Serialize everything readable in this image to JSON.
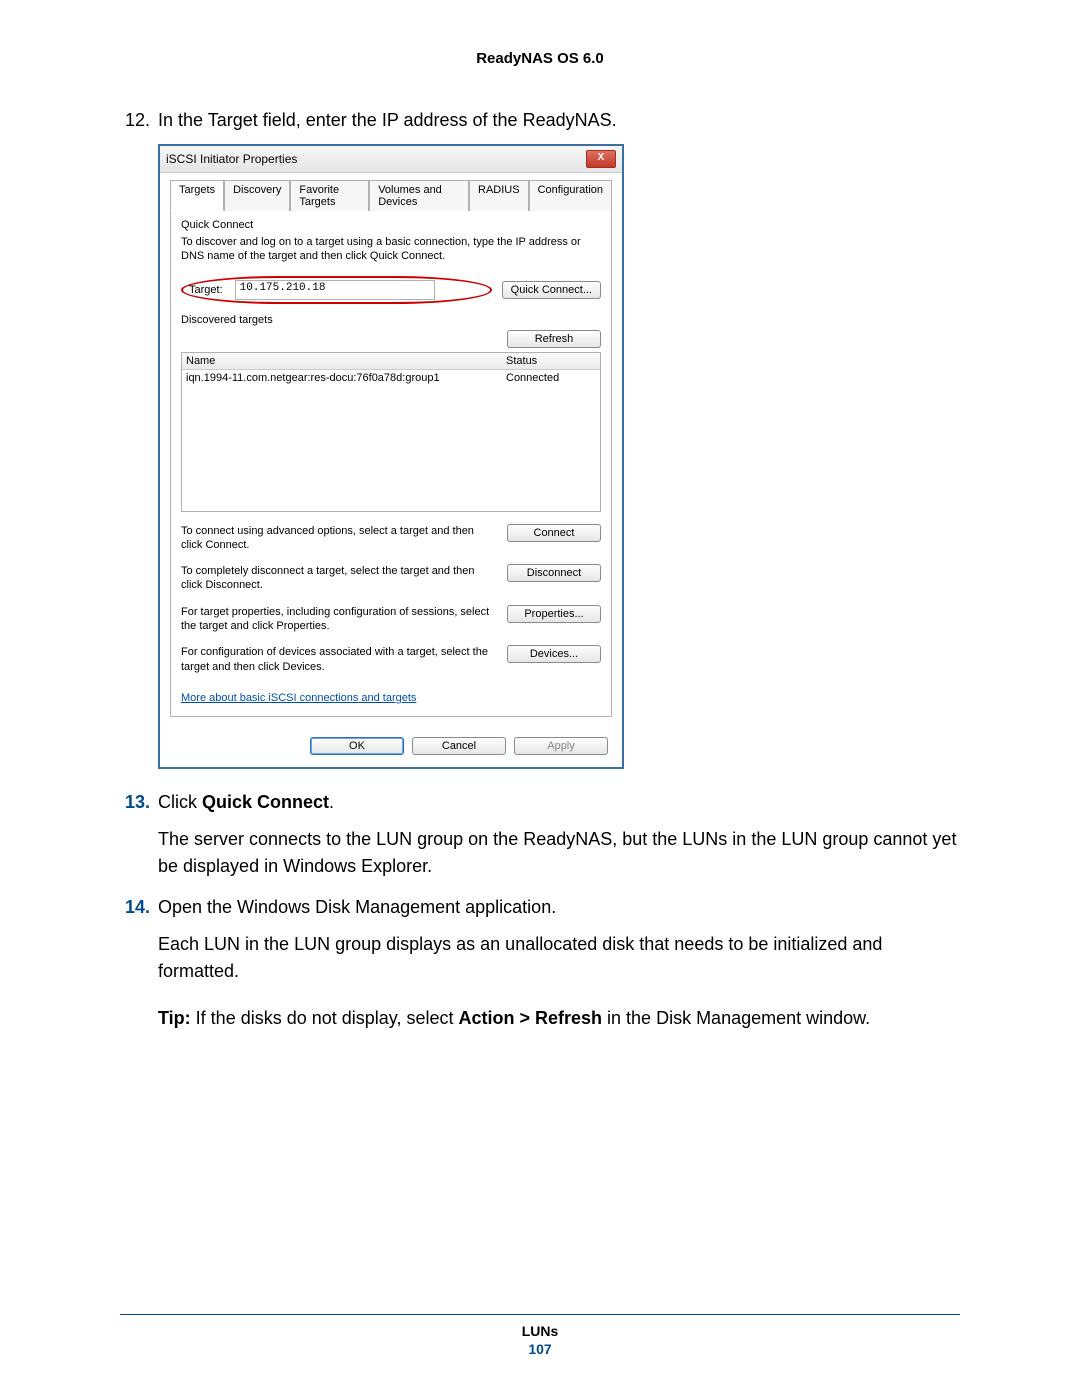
{
  "doc_header": "ReadyNAS OS 6.0",
  "steps": {
    "s12": {
      "num": "12.",
      "text": "In the Target field, enter the IP address of the ReadyNAS."
    },
    "s13": {
      "num": "13.",
      "text_pre": "Click ",
      "bold": "Quick Connect",
      "text_post": "."
    },
    "s13_sub": "The server connects to the LUN group on the ReadyNAS, but the LUNs in the LUN group cannot yet be displayed in Windows Explorer.",
    "s14": {
      "num": "14.",
      "text": "Open the Windows Disk Management application."
    },
    "s14_sub": "Each LUN in the LUN group displays as an unallocated disk that needs to be initialized and formatted.",
    "tip_label": "Tip:",
    "tip_pre": "  If the disks do not display, select ",
    "tip_bold": "Action > Refresh",
    "tip_post": " in the Disk Management window."
  },
  "dialog": {
    "title": "iSCSI Initiator Properties",
    "close": "X",
    "tabs": [
      "Targets",
      "Discovery",
      "Favorite Targets",
      "Volumes and Devices",
      "RADIUS",
      "Configuration"
    ],
    "quick_connect_label": "Quick Connect",
    "quick_connect_desc": "To discover and log on to a target using a basic connection, type the IP address or DNS name of the target and then click Quick Connect.",
    "target_label": "Target:",
    "target_value": "10.175.210.18",
    "quick_connect_btn": "Quick Connect...",
    "discovered_label": "Discovered targets",
    "refresh_btn": "Refresh",
    "col_name": "Name",
    "col_status": "Status",
    "row_name": "iqn.1994-11.com.netgear:res-docu:76f0a78d:group1",
    "row_status": "Connected",
    "act1": "To connect using advanced options, select a target and then click Connect.",
    "btn1": "Connect",
    "act2": "To completely disconnect a target, select the target and then click Disconnect.",
    "btn2": "Disconnect",
    "act3": "For target properties, including configuration of sessions, select the target and click Properties.",
    "btn3": "Properties...",
    "act4": "For configuration of devices associated with a target, select the target and then click Devices.",
    "btn4": "Devices...",
    "more_link": "More about basic iSCSI connections and targets",
    "ok": "OK",
    "cancel": "Cancel",
    "apply": "Apply"
  },
  "footer": {
    "section": "LUNs",
    "page": "107"
  }
}
